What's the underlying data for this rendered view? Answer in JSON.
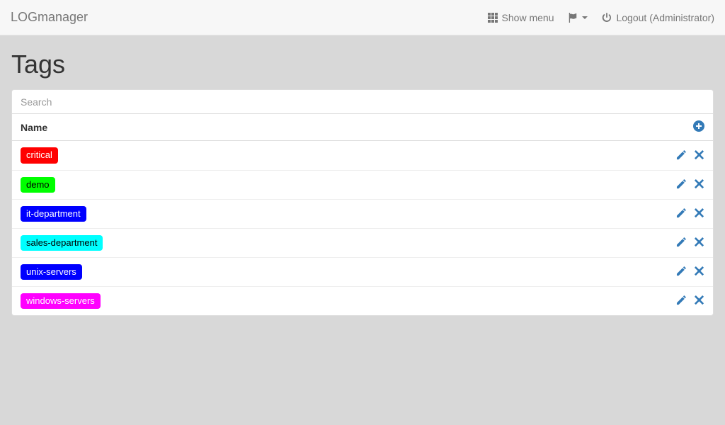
{
  "navbar": {
    "brand": "LOGmanager",
    "show_menu": "Show menu",
    "logout": "Logout (Administrator)"
  },
  "page": {
    "title": "Tags",
    "search_placeholder": "Search",
    "column_name": "Name"
  },
  "tags": [
    {
      "label": "critical",
      "bg": "#ff0000",
      "fg": "#ffffff"
    },
    {
      "label": "demo",
      "bg": "#00ff00",
      "fg": "#000000"
    },
    {
      "label": "it-department",
      "bg": "#0000ff",
      "fg": "#ffffff"
    },
    {
      "label": "sales-department",
      "bg": "#00ffff",
      "fg": "#000000"
    },
    {
      "label": "unix-servers",
      "bg": "#0000ff",
      "fg": "#ffffff"
    },
    {
      "label": "windows-servers",
      "bg": "#ff00ff",
      "fg": "#ffffff"
    }
  ]
}
